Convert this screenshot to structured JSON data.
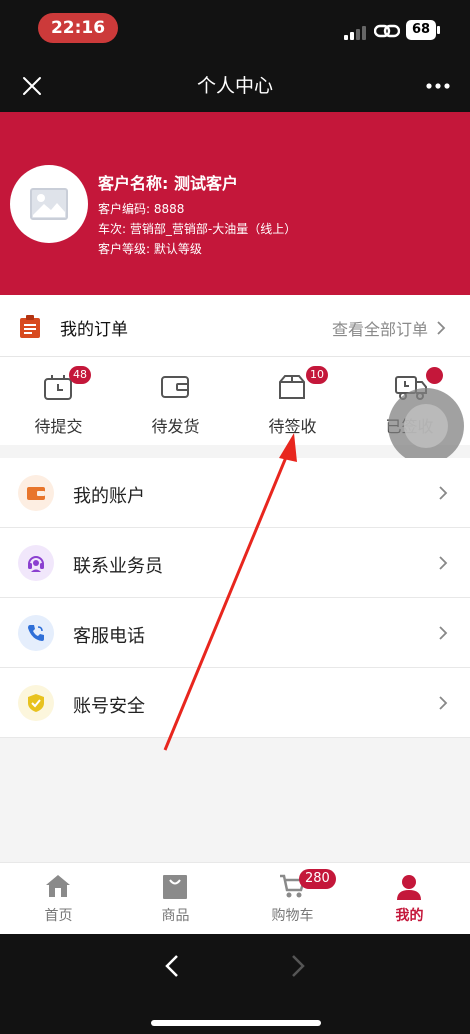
{
  "status_bar": {
    "time": "22:16",
    "battery": "68"
  },
  "nav": {
    "title": "个人中心"
  },
  "profile": {
    "name": "客户名称: 测试客户",
    "code": "客户编码: 8888",
    "route": "车次: 营销部_营销部-大油量（线上）",
    "level": "客户等级: 默认等级"
  },
  "orders": {
    "title": "我的订单",
    "view_all": "查看全部订单",
    "statuses": [
      {
        "label": "待提交",
        "badge": "48",
        "icon": "clock-box-icon"
      },
      {
        "label": "待发货",
        "badge": "",
        "icon": "wallet-box-icon"
      },
      {
        "label": "待签收",
        "badge": "10",
        "icon": "package-icon"
      },
      {
        "label": "已签收",
        "badge": "",
        "icon": "truck-clock-icon"
      }
    ]
  },
  "menu": [
    {
      "label": "我的账户",
      "icon": "wallet-icon",
      "color": "#e8752b"
    },
    {
      "label": "联系业务员",
      "icon": "headset-icon",
      "color": "#8b3fd0"
    },
    {
      "label": "客服电话",
      "icon": "phone-icon",
      "color": "#2f6fd8"
    },
    {
      "label": "账号安全",
      "icon": "shield-icon",
      "color": "#e8c21e"
    }
  ],
  "tabs": [
    {
      "label": "首页",
      "icon": "home-icon"
    },
    {
      "label": "商品",
      "icon": "bag-icon"
    },
    {
      "label": "购物车",
      "icon": "cart-icon",
      "badge": "280"
    },
    {
      "label": "我的",
      "icon": "user-icon",
      "active": true
    }
  ],
  "colors": {
    "brand": "#c4173a",
    "dark_bar": "#121212"
  }
}
